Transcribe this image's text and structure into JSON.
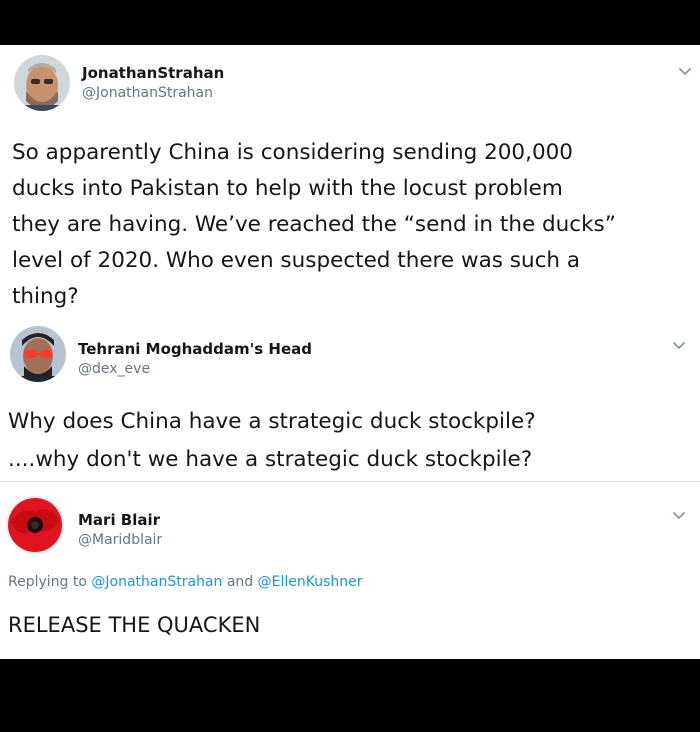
{
  "tweets": [
    {
      "display_name": "JonathanStrahan",
      "handle": "@JonathanStrahan",
      "avatar": "profile-photo-man-beard",
      "menu_icon": "chevron-down-icon",
      "text_lines": [
        "So apparently China is considering sending 200,000",
        "ducks into Pakistan to help with the locust problem",
        "they are having. We’ve reached the “send in the ducks”",
        "level of 2020. Who even suspected there was such a",
        "thing?"
      ]
    },
    {
      "display_name": "Tehrani Moghaddam's Head",
      "handle": "@dex_eve",
      "avatar": "profile-photo-man-red-glasses",
      "menu_icon": "chevron-down-icon",
      "text_lines": [
        "Why does China have a strategic duck stockpile?",
        "....why don't we have a strategic duck stockpile?"
      ]
    },
    {
      "display_name": "Mari Blair",
      "handle": "@Maridblair",
      "avatar": "red-poppy-flower",
      "menu_icon": "chevron-down-icon",
      "reply_prefix": "Replying to",
      "reply_mention_1": "@JonathanStrahan",
      "reply_and": "and",
      "reply_mention_2": "@EllenKushner",
      "text_lines": [
        "RELEASE THE QUACKEN"
      ]
    }
  ],
  "colors": {
    "background": "#000000",
    "card": "#ffffff",
    "text": "#14171a",
    "muted": "#657786",
    "link": "#1b95e0",
    "divider": "#e1e8ed"
  }
}
